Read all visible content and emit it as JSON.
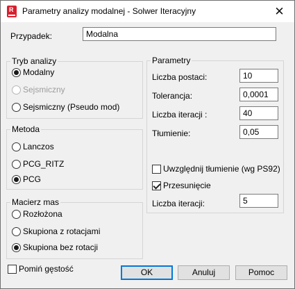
{
  "window": {
    "title": "Parametry analizy modalnej - Solwer Iteracyjny",
    "close_glyph": "✕"
  },
  "case": {
    "label": "Przypadek:",
    "value": "Modalna"
  },
  "analysis_mode": {
    "title": "Tryb analizy",
    "options": [
      {
        "label": "Modalny",
        "checked": true,
        "disabled": false
      },
      {
        "label": "Sejsmiczny",
        "checked": false,
        "disabled": true
      },
      {
        "label": "Sejsmiczny (Pseudo mod)",
        "checked": false,
        "disabled": false
      }
    ]
  },
  "method": {
    "title": "Metoda",
    "options": [
      {
        "label": "Lanczos",
        "checked": false
      },
      {
        "label": "PCG_RITZ",
        "checked": false
      },
      {
        "label": "PCG",
        "checked": true
      }
    ]
  },
  "mass_matrix": {
    "title": "Macierz mas",
    "options": [
      {
        "label": "Rozłożona",
        "checked": false
      },
      {
        "label": "Skupiona z rotacjami",
        "checked": false
      },
      {
        "label": "Skupiona bez rotacji",
        "checked": true
      }
    ]
  },
  "parameters": {
    "title": "Parametry",
    "modes_label": "Liczba postaci:",
    "modes_value": "10",
    "tolerance_label": "Tolerancja:",
    "tolerance_value": "0,0001",
    "iterations_label": "Liczba iteracji :",
    "iterations_value": "40",
    "damping_label": "Tłumienie:",
    "damping_value": "0,05",
    "include_damping_label": "Uwzględnij tłumienie (wg PS92)",
    "include_damping_checked": false,
    "shift_label": "Przesunięcie",
    "shift_checked": true,
    "shift_iterations_label": "Liczba iteracji:",
    "shift_iterations_value": "5"
  },
  "skip_density": {
    "label": "Pomiń gęstość",
    "checked": false
  },
  "buttons": {
    "ok": "OK",
    "cancel": "Anuluj",
    "help": "Pomoc"
  }
}
